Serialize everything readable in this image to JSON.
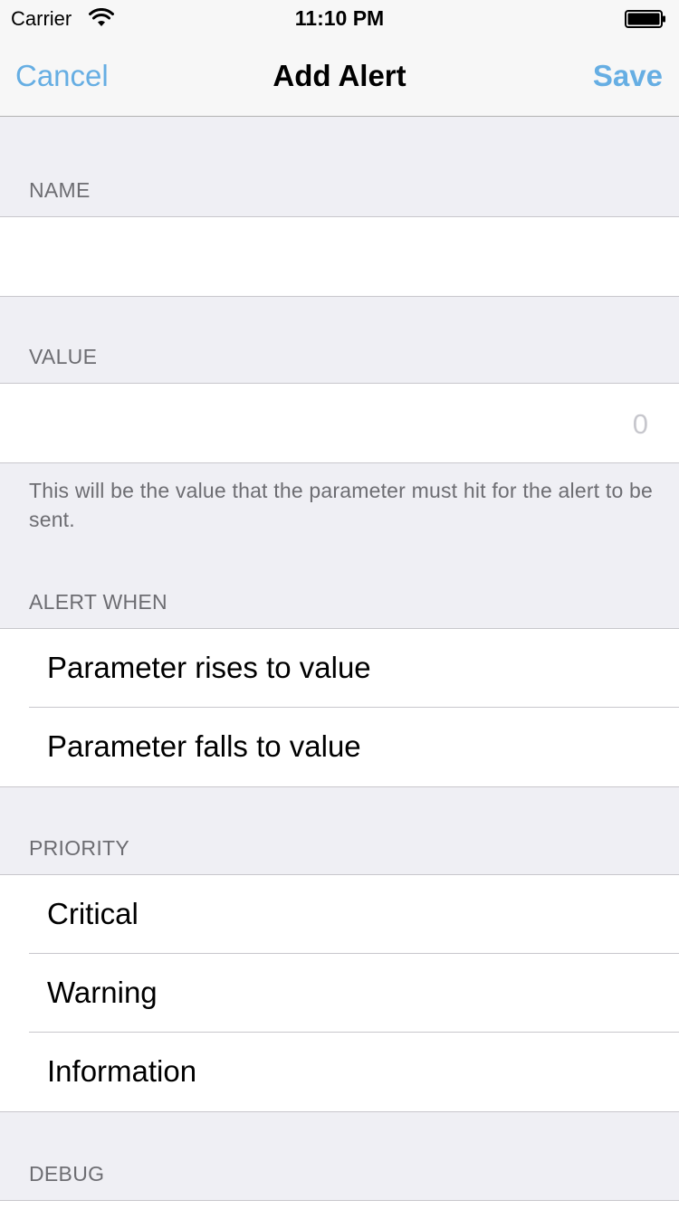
{
  "status_bar": {
    "carrier": "Carrier",
    "time": "11:10 PM",
    "wifi_icon": "wifi-icon",
    "battery_icon": "battery-icon"
  },
  "nav": {
    "cancel_label": "Cancel",
    "title": "Add Alert",
    "save_label": "Save",
    "accent_color": "#66aee3"
  },
  "sections": {
    "name": {
      "header": "NAME",
      "value": "",
      "placeholder": ""
    },
    "value": {
      "header": "VALUE",
      "value": "",
      "placeholder": "0",
      "footer": "This will be the value that the parameter must hit for the alert to be sent."
    },
    "alert_when": {
      "header": "ALERT WHEN",
      "options": [
        {
          "label": "Parameter rises to value"
        },
        {
          "label": "Parameter falls to value"
        }
      ]
    },
    "priority": {
      "header": "PRIORITY",
      "options": [
        {
          "label": "Critical"
        },
        {
          "label": "Warning"
        },
        {
          "label": "Information"
        }
      ]
    },
    "debug": {
      "header": "DEBUG"
    }
  }
}
